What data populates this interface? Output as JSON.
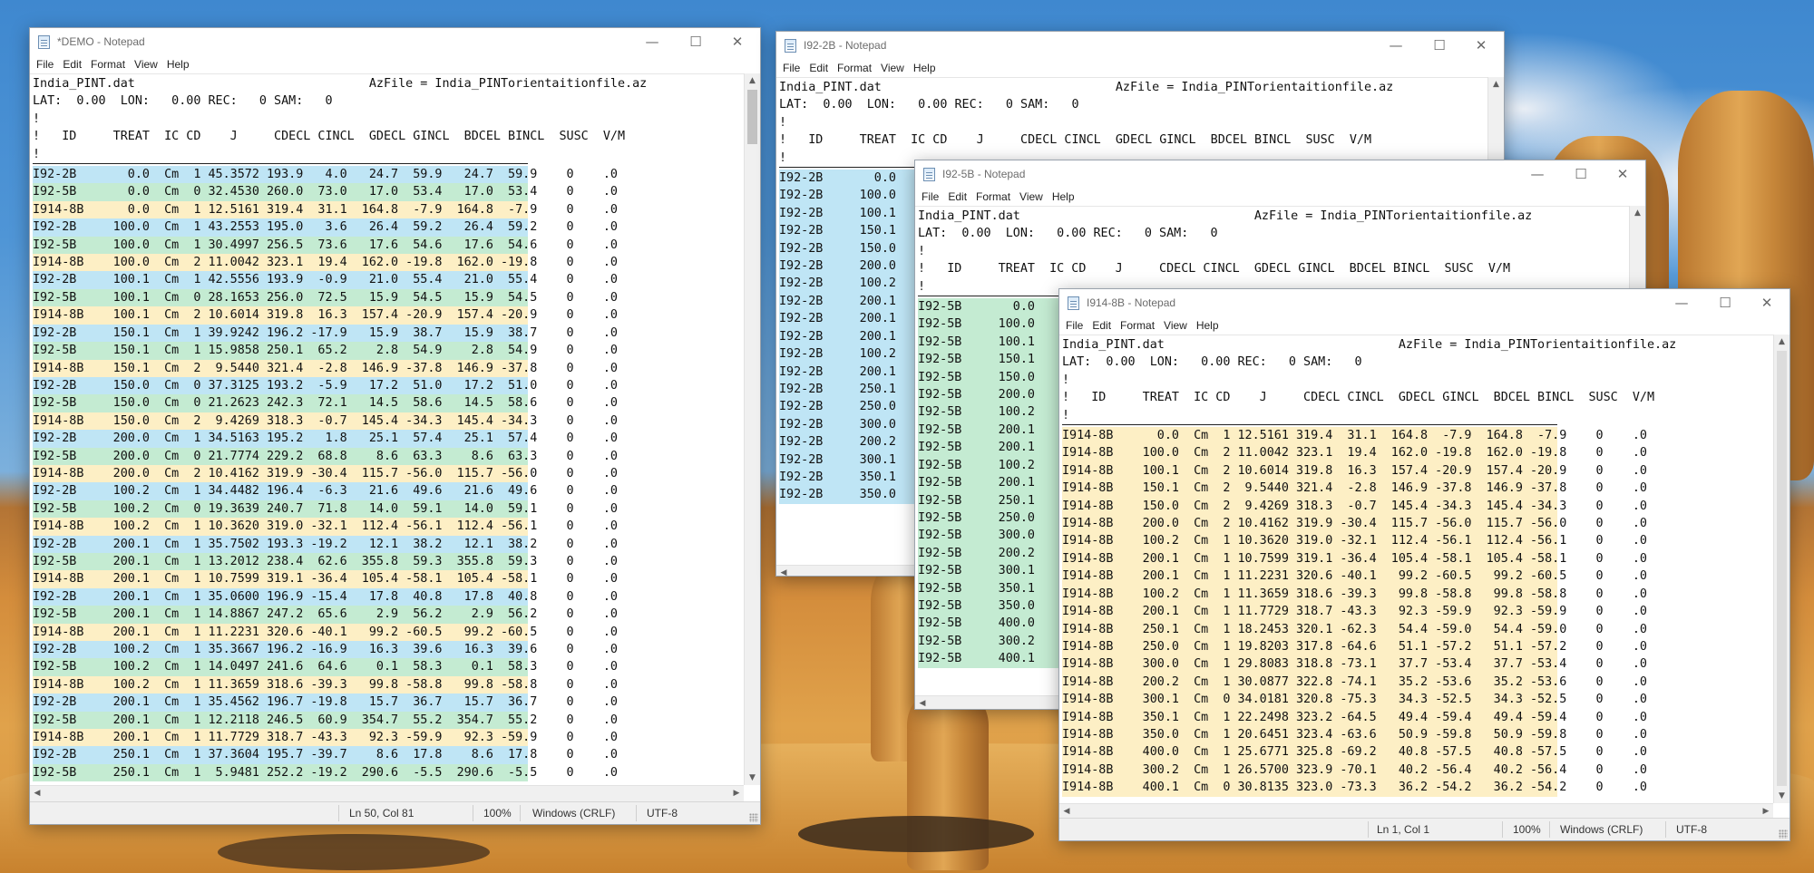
{
  "windows": {
    "demo": {
      "title": "*DEMO - Notepad",
      "menu": [
        "File",
        "Edit",
        "Format",
        "View",
        "Help"
      ],
      "status": {
        "position": "Ln 50, Col 81",
        "zoom": "100%",
        "line_ending": "Windows (CRLF)",
        "encoding": "UTF-8"
      },
      "scroll_thumb_fraction": 0.1,
      "header_lines": [
        "India_PINT.dat                                AzFile = India_PINTorientaitionfile.az",
        "LAT:  0.00  LON:   0.00 REC:   0 SAM:   0",
        "!",
        "!   ID     TREAT  IC CD    J     CDECL CINCL  GDECL GINCL  BDCEL BINCL  SUSC  V/M",
        "!"
      ],
      "data_lines": [
        "I92-2B       0.0  Cm  1 45.3572 193.9   4.0   24.7  59.9   24.7  59.9    0    .0",
        "I92-5B       0.0  Cm  0 32.4530 260.0  73.0   17.0  53.4   17.0  53.4    0    .0",
        "I914-8B      0.0  Cm  1 12.5161 319.4  31.1  164.8  -7.9  164.8  -7.9    0    .0",
        "I92-2B     100.0  Cm  1 43.2553 195.0   3.6   26.4  59.2   26.4  59.2    0    .0",
        "I92-5B     100.0  Cm  1 30.4997 256.5  73.6   17.6  54.6   17.6  54.6    0    .0",
        "I914-8B    100.0  Cm  2 11.0042 323.1  19.4  162.0 -19.8  162.0 -19.8    0    .0",
        "I92-2B     100.1  Cm  1 42.5556 193.9  -0.9   21.0  55.4   21.0  55.4    0    .0",
        "I92-5B     100.1  Cm  0 28.1653 256.0  72.5   15.9  54.5   15.9  54.5    0    .0",
        "I914-8B    100.1  Cm  2 10.6014 319.8  16.3  157.4 -20.9  157.4 -20.9    0    .0",
        "I92-2B     150.1  Cm  1 39.9242 196.2 -17.9   15.9  38.7   15.9  38.7    0    .0",
        "I92-5B     150.1  Cm  1 15.9858 250.1  65.2    2.8  54.9    2.8  54.9    0    .0",
        "I914-8B    150.1  Cm  2  9.5440 321.4  -2.8  146.9 -37.8  146.9 -37.8    0    .0",
        "I92-2B     150.0  Cm  0 37.3125 193.2  -5.9   17.2  51.0   17.2  51.0    0    .0",
        "I92-5B     150.0  Cm  0 21.2623 242.3  72.1   14.5  58.6   14.5  58.6    0    .0",
        "I914-8B    150.0  Cm  2  9.4269 318.3  -0.7  145.4 -34.3  145.4 -34.3    0    .0",
        "I92-2B     200.0  Cm  1 34.5163 195.2   1.8   25.1  57.4   25.1  57.4    0    .0",
        "I92-5B     200.0  Cm  0 21.7774 229.2  68.8    8.6  63.3    8.6  63.3    0    .0",
        "I914-8B    200.0  Cm  2 10.4162 319.9 -30.4  115.7 -56.0  115.7 -56.0    0    .0",
        "I92-2B     100.2  Cm  1 34.4482 196.4  -6.3   21.6  49.6   21.6  49.6    0    .0",
        "I92-5B     100.2  Cm  0 19.3639 240.7  71.8   14.0  59.1   14.0  59.1    0    .0",
        "I914-8B    100.2  Cm  1 10.3620 319.0 -32.1  112.4 -56.1  112.4 -56.1    0    .0",
        "I92-2B     200.1  Cm  1 35.7502 193.3 -19.2   12.1  38.2   12.1  38.2    0    .0",
        "I92-5B     200.1  Cm  1 13.2012 238.4  62.6  355.8  59.3  355.8  59.3    0    .0",
        "I914-8B    200.1  Cm  1 10.7599 319.1 -36.4  105.4 -58.1  105.4 -58.1    0    .0",
        "I92-2B     200.1  Cm  1 35.0600 196.9 -15.4   17.8  40.8   17.8  40.8    0    .0",
        "I92-5B     200.1  Cm  1 14.8867 247.2  65.6    2.9  56.2    2.9  56.2    0    .0",
        "I914-8B    200.1  Cm  1 11.2231 320.6 -40.1   99.2 -60.5   99.2 -60.5    0    .0",
        "I92-2B     100.2  Cm  1 35.3667 196.2 -16.9   16.3  39.6   16.3  39.6    0    .0",
        "I92-5B     100.2  Cm  1 14.0497 241.6  64.6    0.1  58.3    0.1  58.3    0    .0",
        "I914-8B    100.2  Cm  1 11.3659 318.6 -39.3   99.8 -58.8   99.8 -58.8    0    .0",
        "I92-2B     200.1  Cm  1 35.4562 196.7 -19.8   15.7  36.7   15.7  36.7    0    .0",
        "I92-5B     200.1  Cm  1 12.2118 246.5  60.9  354.7  55.2  354.7  55.2    0    .0",
        "I914-8B    200.1  Cm  1 11.7729 318.7 -43.3   92.3 -59.9   92.3 -59.9    0    .0",
        "I92-2B     250.1  Cm  1 37.3604 195.7 -39.7    8.6  17.8    8.6  17.8    0    .0",
        "I92-5B     250.1  Cm  1  5.9481 252.2 -19.2  290.6  -5.5  290.6  -5.5    0    .0"
      ]
    },
    "w2b": {
      "title": "I92-2B - Notepad",
      "menu": [
        "File",
        "Edit",
        "Format",
        "View",
        "Help"
      ],
      "header_lines": [
        "India_PINT.dat                                AzFile = India_PINTorientaitionfile.az",
        "LAT:  0.00  LON:   0.00 REC:   0 SAM:   0",
        "!",
        "!   ID     TREAT  IC CD    J     CDECL CINCL  GDECL GINCL  BDCEL BINCL  SUSC  V/M",
        "!"
      ],
      "data_lines": [
        "I92-2B       0.0",
        "I92-2B     100.0",
        "I92-2B     100.1",
        "I92-2B     150.1",
        "I92-2B     150.0",
        "I92-2B     200.0",
        "I92-2B     100.2",
        "I92-2B     200.1",
        "I92-2B     200.1",
        "I92-2B     200.1",
        "I92-2B     100.2",
        "I92-2B     200.1",
        "I92-2B     250.1",
        "I92-2B     250.0",
        "I92-2B     300.0",
        "I92-2B     200.2",
        "I92-2B     300.1",
        "I92-2B     350.1",
        "I92-2B     350.0"
      ]
    },
    "w5b": {
      "title": "I92-5B - Notepad",
      "menu": [
        "File",
        "Edit",
        "Format",
        "View",
        "Help"
      ],
      "header_lines": [
        "India_PINT.dat                                AzFile = India_PINTorientaitionfile.az",
        "LAT:  0.00  LON:   0.00 REC:   0 SAM:   0",
        "!",
        "!   ID     TREAT  IC CD    J     CDECL CINCL  GDECL GINCL  BDCEL BINCL  SUSC  V/M",
        "!"
      ],
      "data_lines": [
        "I92-5B       0.0",
        "I92-5B     100.0",
        "I92-5B     100.1",
        "I92-5B     150.1",
        "I92-5B     150.0",
        "I92-5B     200.0",
        "I92-5B     100.2",
        "I92-5B     200.1",
        "I92-5B     200.1",
        "I92-5B     100.2",
        "I92-5B     200.1",
        "I92-5B     250.1",
        "I92-5B     250.0",
        "I92-5B     300.0",
        "I92-5B     200.2",
        "I92-5B     300.1",
        "I92-5B     350.1",
        "I92-5B     350.0",
        "I92-5B     400.0",
        "I92-5B     300.2",
        "I92-5B     400.1"
      ]
    },
    "w8b": {
      "title": "I914-8B - Notepad",
      "menu": [
        "File",
        "Edit",
        "Format",
        "View",
        "Help"
      ],
      "status": {
        "position": "Ln 1, Col 1",
        "zoom": "100%",
        "line_ending": "Windows (CRLF)",
        "encoding": "UTF-8"
      },
      "header_lines": [
        "India_PINT.dat                                AzFile = India_PINTorientaitionfile.az",
        "LAT:  0.00  LON:   0.00 REC:   0 SAM:   0",
        "!",
        "!   ID     TREAT  IC CD    J     CDECL CINCL  GDECL GINCL  BDCEL BINCL  SUSC  V/M",
        "!"
      ],
      "data_lines": [
        "I914-8B      0.0  Cm  1 12.5161 319.4  31.1  164.8  -7.9  164.8  -7.9    0    .0",
        "I914-8B    100.0  Cm  2 11.0042 323.1  19.4  162.0 -19.8  162.0 -19.8    0    .0",
        "I914-8B    100.1  Cm  2 10.6014 319.8  16.3  157.4 -20.9  157.4 -20.9    0    .0",
        "I914-8B    150.1  Cm  2  9.5440 321.4  -2.8  146.9 -37.8  146.9 -37.8    0    .0",
        "I914-8B    150.0  Cm  2  9.4269 318.3  -0.7  145.4 -34.3  145.4 -34.3    0    .0",
        "I914-8B    200.0  Cm  2 10.4162 319.9 -30.4  115.7 -56.0  115.7 -56.0    0    .0",
        "I914-8B    100.2  Cm  1 10.3620 319.0 -32.1  112.4 -56.1  112.4 -56.1    0    .0",
        "I914-8B    200.1  Cm  1 10.7599 319.1 -36.4  105.4 -58.1  105.4 -58.1    0    .0",
        "I914-8B    200.1  Cm  1 11.2231 320.6 -40.1   99.2 -60.5   99.2 -60.5    0    .0",
        "I914-8B    100.2  Cm  1 11.3659 318.6 -39.3   99.8 -58.8   99.8 -58.8    0    .0",
        "I914-8B    200.1  Cm  1 11.7729 318.7 -43.3   92.3 -59.9   92.3 -59.9    0    .0",
        "I914-8B    250.1  Cm  1 18.2453 320.1 -62.3   54.4 -59.0   54.4 -59.0    0    .0",
        "I914-8B    250.0  Cm  1 19.8203 317.8 -64.6   51.1 -57.2   51.1 -57.2    0    .0",
        "I914-8B    300.0  Cm  1 29.8083 318.8 -73.1   37.7 -53.4   37.7 -53.4    0    .0",
        "I914-8B    200.2  Cm  1 30.0877 322.8 -74.1   35.2 -53.6   35.2 -53.6    0    .0",
        "I914-8B    300.1  Cm  0 34.0181 320.8 -75.3   34.3 -52.5   34.3 -52.5    0    .0",
        "I914-8B    350.1  Cm  1 22.2498 323.2 -64.5   49.4 -59.4   49.4 -59.4    0    .0",
        "I914-8B    350.0  Cm  1 20.6451 323.4 -63.6   50.9 -59.8   50.9 -59.8    0    .0",
        "I914-8B    400.0  Cm  1 25.6771 325.8 -69.2   40.8 -57.5   40.8 -57.5    0    .0",
        "I914-8B    300.2  Cm  1 26.5700 323.9 -70.1   40.2 -56.4   40.2 -56.4    0    .0",
        "I914-8B    400.1  Cm  0 30.8135 323.0 -73.3   36.2 -54.2   36.2 -54.2    0    .0"
      ]
    }
  },
  "colors": {
    "I92-2B": "#bfe5f5",
    "I92-5B": "#c4ebd2",
    "I914-8B": "#fdefc5"
  },
  "icons": {
    "minimize": "—",
    "maximize": "☐",
    "close": "✕",
    "scroll_up": "▲",
    "scroll_down": "▼",
    "scroll_left": "◀",
    "scroll_right": "▶"
  }
}
